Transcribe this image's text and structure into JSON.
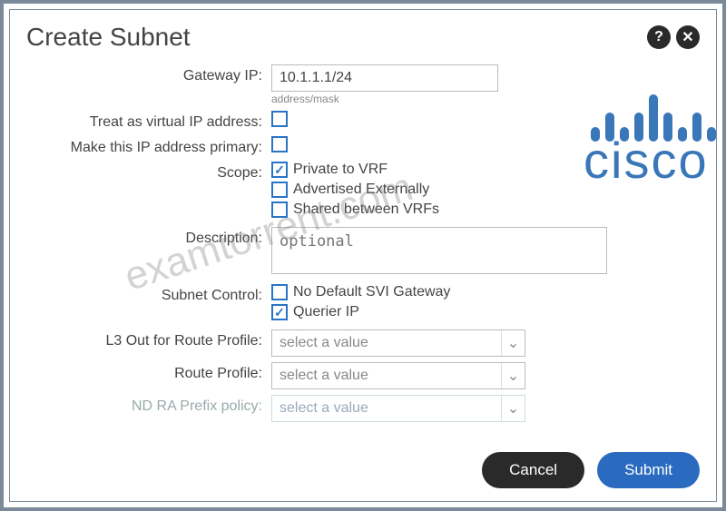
{
  "title": "Create Subnet",
  "labels": {
    "gateway_ip": "Gateway IP:",
    "gateway_hint": "address/mask",
    "treat_virtual": "Treat as virtual IP address:",
    "make_primary": "Make this IP address primary:",
    "scope": "Scope:",
    "description": "Description:",
    "subnet_control": "Subnet Control:",
    "l3out": "L3 Out for Route Profile:",
    "route_profile": "Route Profile:",
    "ndra": "ND RA Prefix policy:"
  },
  "values": {
    "gateway_ip": "10.1.1.1/24",
    "description_placeholder": "optional",
    "select_placeholder": "select a value"
  },
  "scope": {
    "private_vrf": "Private to VRF",
    "advertised": "Advertised Externally",
    "shared": "Shared between VRFs"
  },
  "subnet_control": {
    "no_default_svi": "No Default SVI Gateway",
    "querier_ip": "Querier IP"
  },
  "buttons": {
    "cancel": "Cancel",
    "submit": "Submit"
  },
  "watermark": "examtorrent.com",
  "logo_text": "cisco"
}
